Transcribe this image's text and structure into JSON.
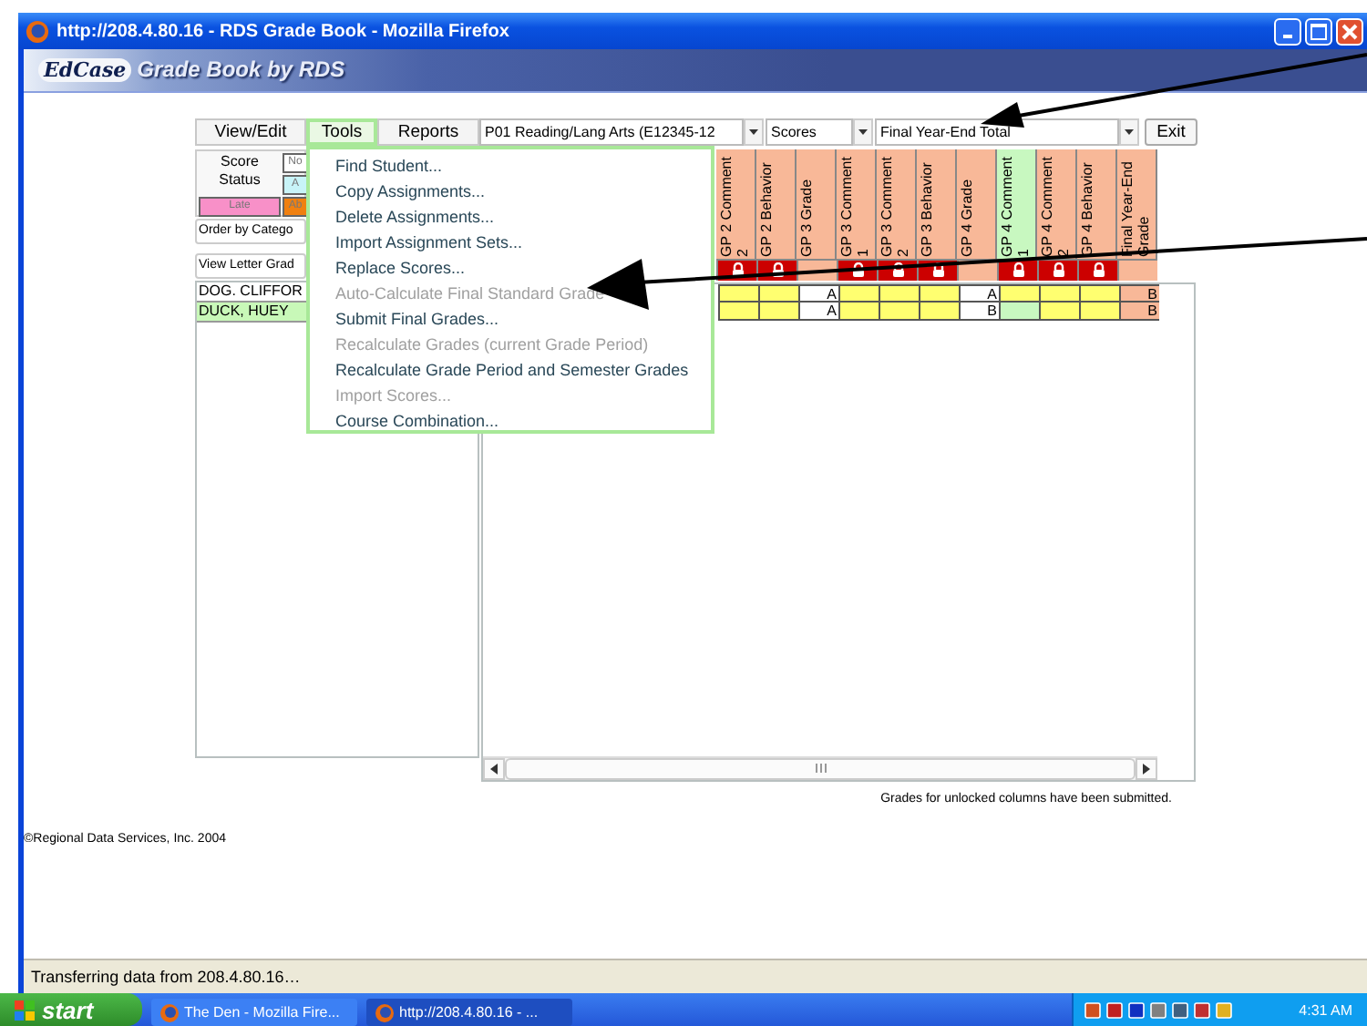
{
  "window": {
    "title": "http://208.4.80.16 - RDS Grade Book - Mozilla Firefox"
  },
  "banner": {
    "logo": "EdCase",
    "title": "Grade Book by RDS"
  },
  "tabs": [
    {
      "label": "View/Edit",
      "selected": false
    },
    {
      "label": "Tools",
      "selected": true
    },
    {
      "label": "Reports",
      "selected": false
    }
  ],
  "selectors": [
    {
      "value": "P01   Reading/Lang Arts   (E12345-12"
    },
    {
      "value": "Scores"
    },
    {
      "value": "Final Year-End Total"
    }
  ],
  "exit_button": "Exit",
  "legend": {
    "label": "Score Status",
    "swatches": [
      {
        "label": "No",
        "color": "#ffffff"
      },
      {
        "label": "A",
        "color": "#c8f4f8"
      },
      {
        "label": "Late",
        "color": "#f890c8"
      },
      {
        "label": "Ab",
        "color": "#f08010"
      }
    ]
  },
  "order_select": "Order by Catego",
  "view_select": "View Letter Grad",
  "students": [
    {
      "name": "DOG. CLIFFOR",
      "selected": false
    },
    {
      "name": "DUCK, HUEY",
      "selected": true
    }
  ],
  "columns": [
    {
      "header": "GP 2 Comment 2",
      "kind": "comment",
      "locked": true,
      "highlighted": false
    },
    {
      "header": "GP 2 Behavior",
      "kind": "comment",
      "locked": true,
      "highlighted": false
    },
    {
      "header": "GP 3 Grade",
      "kind": "grade",
      "locked": false,
      "highlighted": false
    },
    {
      "header": "GP 3 Comment 1",
      "kind": "comment",
      "locked": true,
      "highlighted": false
    },
    {
      "header": "GP 3 Comment 2",
      "kind": "comment",
      "locked": true,
      "highlighted": false
    },
    {
      "header": "GP 3 Behavior",
      "kind": "comment",
      "locked": true,
      "highlighted": false
    },
    {
      "header": "GP 4 Grade",
      "kind": "grade",
      "locked": false,
      "highlighted": false
    },
    {
      "header": "GP 4 Comment 1",
      "kind": "comment",
      "locked": true,
      "highlighted": true
    },
    {
      "header": "GP 4 Comment 2",
      "kind": "comment",
      "locked": true,
      "highlighted": false
    },
    {
      "header": "GP 4 Behavior",
      "kind": "comment",
      "locked": true,
      "highlighted": false
    },
    {
      "header": "Final Year-End Grade",
      "kind": "final",
      "locked": false,
      "highlighted": false
    }
  ],
  "rows": [
    {
      "cells": [
        "",
        "",
        "A",
        "",
        "",
        "",
        "A",
        "",
        "",
        "",
        "B"
      ]
    },
    {
      "cells": [
        "",
        "",
        "A",
        "",
        "",
        "",
        "B",
        "",
        "",
        "",
        "B"
      ]
    }
  ],
  "menu": {
    "items": [
      {
        "label": "Find Student...",
        "disabled": false
      },
      {
        "label": "Copy Assignments...",
        "disabled": false
      },
      {
        "label": "Delete Assignments...",
        "disabled": false
      },
      {
        "label": "Import Assignment Sets...",
        "disabled": false
      },
      {
        "label": "Replace Scores...",
        "disabled": false
      },
      {
        "label": "Auto-Calculate Final Standard Grade",
        "disabled": true
      },
      {
        "label": "Submit Final Grades...",
        "disabled": false
      },
      {
        "label": "Recalculate Grades (current Grade Period)",
        "disabled": true
      },
      {
        "label": "Recalculate Grade Period and Semester Grades",
        "disabled": false
      },
      {
        "label": "Import Scores...",
        "disabled": true
      },
      {
        "label": "Course Combination...",
        "disabled": false
      }
    ]
  },
  "note": "Grades for unlocked columns have been submitted.",
  "copyright": "©Regional Data Services, Inc. 2004",
  "status_bar": "Transferring data from 208.4.80.16…",
  "taskbar": {
    "start": "start",
    "tasks": [
      {
        "label": "The Den - Mozilla Fire...",
        "selected": false
      },
      {
        "label": "http://208.4.80.16 - ...",
        "selected": true
      }
    ],
    "clock": "4:31 AM"
  }
}
